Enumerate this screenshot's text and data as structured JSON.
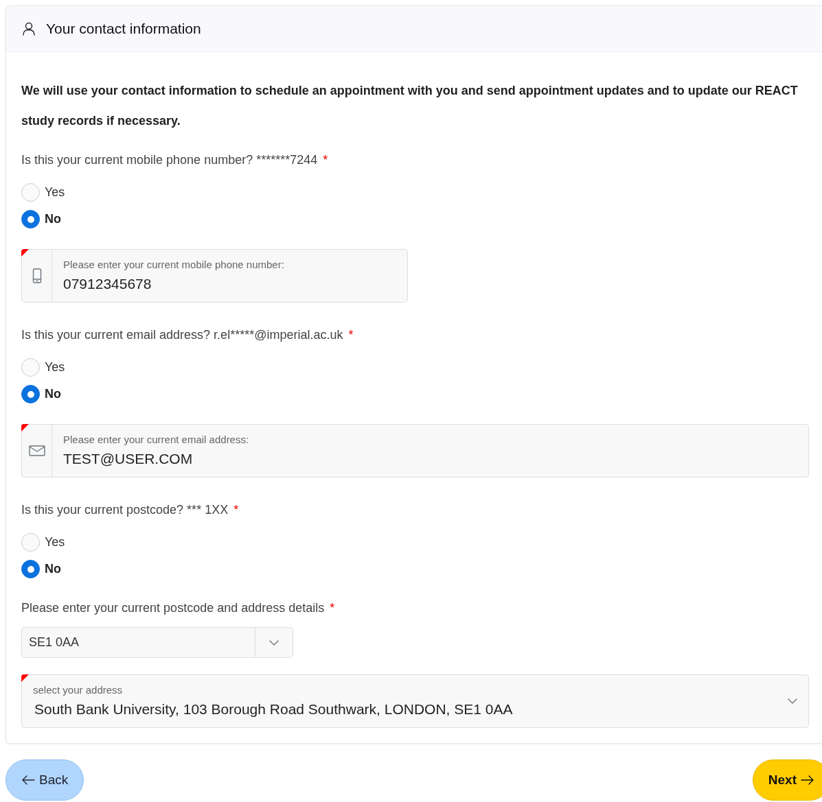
{
  "card": {
    "title": "Your contact information",
    "intro": "We will use your contact information to schedule an appointment with you and send appointment updates and to update our REACT study records if necessary.",
    "questions": [
      {
        "label": "Is this your current mobile phone number? *******7244",
        "required_mark": "*",
        "options": [
          {
            "label": "Yes",
            "selected": false
          },
          {
            "label": "No",
            "selected": true
          }
        ],
        "field": {
          "kind": "phone",
          "label": "Please enter your current mobile phone number:",
          "value": "07912345678",
          "invalid": true
        }
      },
      {
        "label": "Is this your current email address? r.el*****@imperial.ac.uk",
        "required_mark": "*",
        "options": [
          {
            "label": "Yes",
            "selected": false
          },
          {
            "label": "No",
            "selected": true
          }
        ],
        "field": {
          "kind": "email",
          "label": "Please enter your current email address:",
          "value": "TEST@USER.COM",
          "invalid": true
        }
      },
      {
        "label": "Is this your current postcode? *** 1XX",
        "required_mark": "*",
        "options": [
          {
            "label": "Yes",
            "selected": false
          },
          {
            "label": "No",
            "selected": true
          }
        ]
      }
    ],
    "address": {
      "label": "Please enter your current postcode and address details",
      "required_mark": "*",
      "postcode": "SE1 0AA",
      "select": {
        "label": "select your address",
        "value": "South Bank University, 103 Borough Road Southwark, LONDON, SE1 0AA",
        "invalid": true
      }
    }
  },
  "buttons": [
    {
      "kind": "back",
      "label": "Back"
    },
    {
      "kind": "next",
      "label": "Next"
    }
  ]
}
